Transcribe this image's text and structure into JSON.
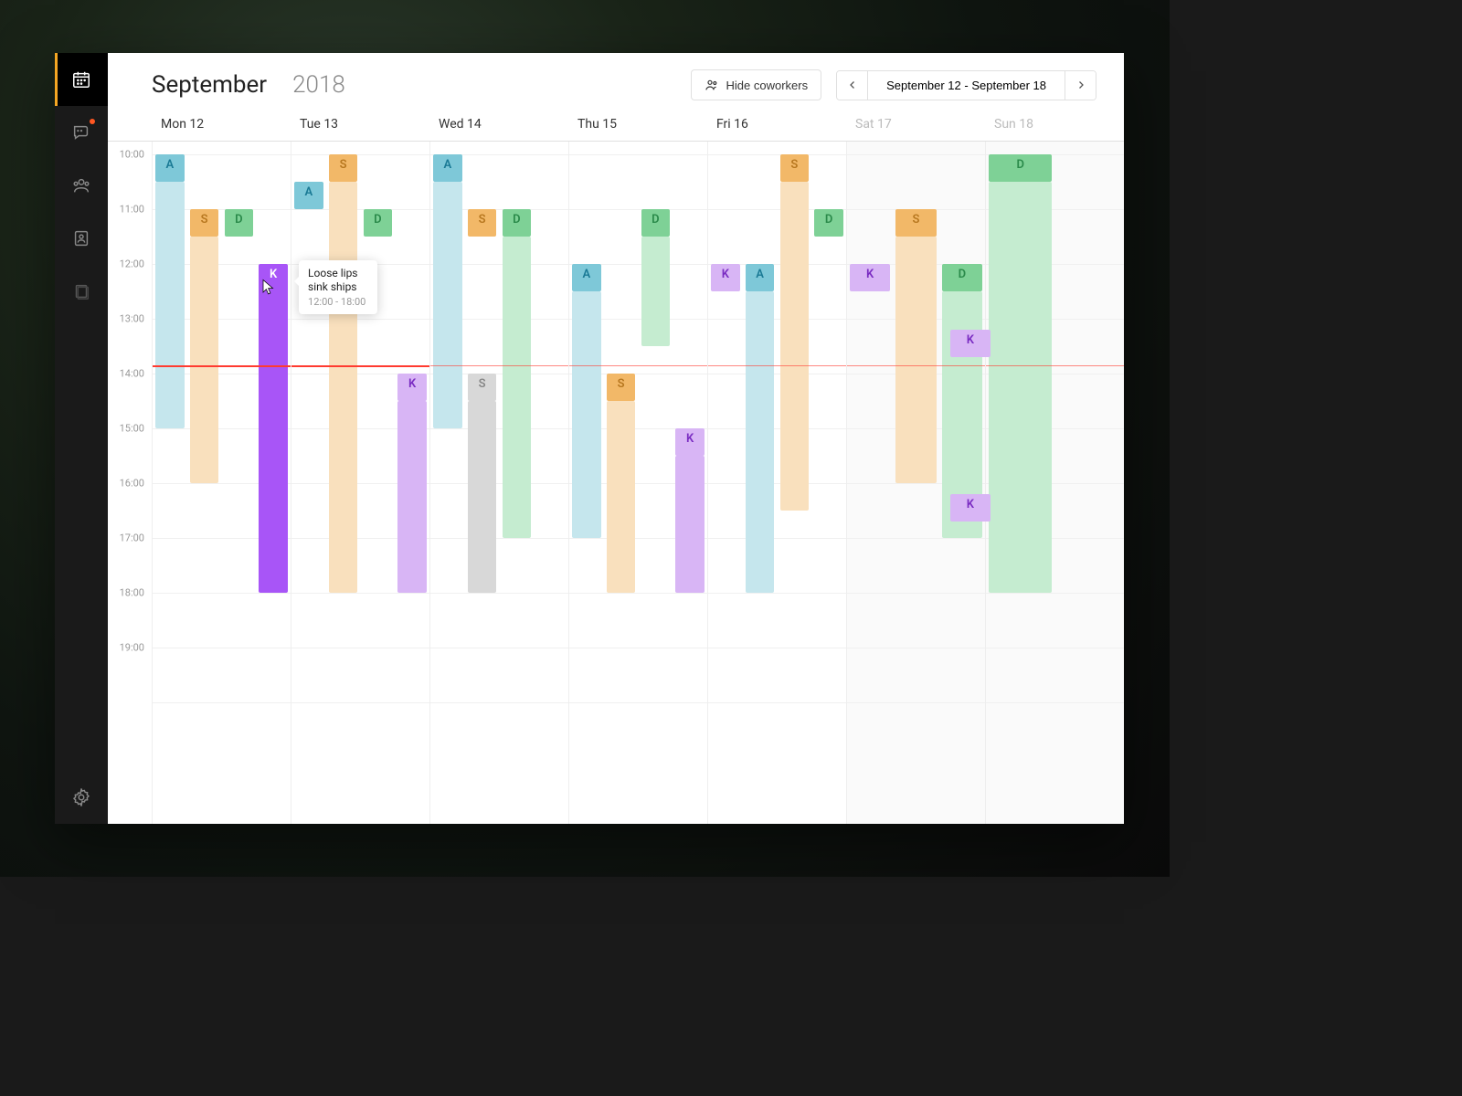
{
  "title": {
    "month": "September",
    "year": "2018"
  },
  "hide_coworkers": "Hide coworkers",
  "range": {
    "label": "September 12  -  September 18"
  },
  "days": [
    {
      "label": "Mon 12",
      "weekend": false
    },
    {
      "label": "Tue 13",
      "weekend": false
    },
    {
      "label": "Wed 14",
      "weekend": false
    },
    {
      "label": "Thu 15",
      "weekend": false
    },
    {
      "label": "Fri 16",
      "weekend": false
    },
    {
      "label": "Sat 17",
      "weekend": true
    },
    {
      "label": "Sun 18",
      "weekend": true
    }
  ],
  "hours": [
    "10:00",
    "11:00",
    "12:00",
    "13:00",
    "14:00",
    "15:00",
    "16:00",
    "17:00",
    "18:00",
    "19:00"
  ],
  "hour_start": 10,
  "hour_end": 20,
  "hour_height": 60,
  "now_hour": 13.85,
  "tooltip": {
    "title": "Loose lips sink ships",
    "time": "12:00 - 18:00"
  },
  "people": {
    "A": "A",
    "S": "S",
    "D": "D",
    "K": "K"
  },
  "events": [
    {
      "day": 0,
      "lane": 0,
      "lanes": 4,
      "start": 10,
      "end": 10.5,
      "who": "A",
      "cls": "ev-a-solid"
    },
    {
      "day": 0,
      "lane": 0,
      "lanes": 4,
      "start": 10.5,
      "end": 15,
      "who": "",
      "cls": "ev-a-light"
    },
    {
      "day": 0,
      "lane": 1,
      "lanes": 4,
      "start": 11,
      "end": 11.5,
      "who": "S",
      "cls": "ev-s-solid"
    },
    {
      "day": 0,
      "lane": 1,
      "lanes": 4,
      "start": 11.5,
      "end": 16,
      "who": "",
      "cls": "ev-s-light"
    },
    {
      "day": 0,
      "lane": 2,
      "lanes": 4,
      "start": 11,
      "end": 11.5,
      "who": "D",
      "cls": "ev-d-solid"
    },
    {
      "day": 0,
      "lane": 3,
      "lanes": 4,
      "start": 12,
      "end": 18,
      "who": "K",
      "cls": "ev-k-solid",
      "tooltip": true
    },
    {
      "day": 1,
      "lane": 0,
      "lanes": 4,
      "start": 10.5,
      "end": 11,
      "who": "A",
      "cls": "ev-a-solid"
    },
    {
      "day": 1,
      "lane": 1,
      "lanes": 4,
      "start": 10,
      "end": 10.5,
      "who": "S",
      "cls": "ev-s-solid"
    },
    {
      "day": 1,
      "lane": 1,
      "lanes": 4,
      "start": 10.5,
      "end": 18,
      "who": "",
      "cls": "ev-s-light"
    },
    {
      "day": 1,
      "lane": 2,
      "lanes": 4,
      "start": 11,
      "end": 11.5,
      "who": "D",
      "cls": "ev-d-solid"
    },
    {
      "day": 1,
      "lane": 3,
      "lanes": 4,
      "start": 14,
      "end": 14.5,
      "who": "K",
      "cls": "ev-k-light"
    },
    {
      "day": 1,
      "lane": 3,
      "lanes": 4,
      "start": 14.5,
      "end": 18,
      "who": "",
      "cls": "ev-k-light"
    },
    {
      "day": 2,
      "lane": 0,
      "lanes": 4,
      "start": 10,
      "end": 10.5,
      "who": "A",
      "cls": "ev-a-solid"
    },
    {
      "day": 2,
      "lane": 0,
      "lanes": 4,
      "start": 10.5,
      "end": 15,
      "who": "",
      "cls": "ev-a-light"
    },
    {
      "day": 2,
      "lane": 1,
      "lanes": 4,
      "start": 11,
      "end": 11.5,
      "who": "S",
      "cls": "ev-s-solid"
    },
    {
      "day": 2,
      "lane": 1,
      "lanes": 4,
      "start": 14,
      "end": 14.5,
      "who": "S",
      "cls": "ev-s-gray"
    },
    {
      "day": 2,
      "lane": 1,
      "lanes": 4,
      "start": 14.5,
      "end": 18,
      "who": "",
      "cls": "ev-s-gray"
    },
    {
      "day": 2,
      "lane": 2,
      "lanes": 4,
      "start": 11,
      "end": 11.5,
      "who": "D",
      "cls": "ev-d-solid"
    },
    {
      "day": 2,
      "lane": 2,
      "lanes": 4,
      "start": 11.5,
      "end": 17,
      "who": "",
      "cls": "ev-d-light"
    },
    {
      "day": 3,
      "lane": 0,
      "lanes": 4,
      "start": 12,
      "end": 12.5,
      "who": "A",
      "cls": "ev-a-solid"
    },
    {
      "day": 3,
      "lane": 0,
      "lanes": 4,
      "start": 12.5,
      "end": 17,
      "who": "",
      "cls": "ev-a-light"
    },
    {
      "day": 3,
      "lane": 1,
      "lanes": 4,
      "start": 14,
      "end": 14.5,
      "who": "S",
      "cls": "ev-s-solid"
    },
    {
      "day": 3,
      "lane": 1,
      "lanes": 4,
      "start": 14.5,
      "end": 18,
      "who": "",
      "cls": "ev-s-light"
    },
    {
      "day": 3,
      "lane": 2,
      "lanes": 4,
      "start": 11,
      "end": 11.5,
      "who": "D",
      "cls": "ev-d-solid"
    },
    {
      "day": 3,
      "lane": 2,
      "lanes": 4,
      "start": 11.5,
      "end": 13.5,
      "who": "",
      "cls": "ev-d-light"
    },
    {
      "day": 3,
      "lane": 3,
      "lanes": 4,
      "start": 15,
      "end": 15.5,
      "who": "K",
      "cls": "ev-k-light"
    },
    {
      "day": 3,
      "lane": 3,
      "lanes": 4,
      "start": 15.5,
      "end": 18,
      "who": "",
      "cls": "ev-k-light"
    },
    {
      "day": 4,
      "lane": 0,
      "lanes": 4,
      "start": 12,
      "end": 12.5,
      "who": "K",
      "cls": "ev-k-light"
    },
    {
      "day": 4,
      "lane": 1,
      "lanes": 4,
      "start": 12,
      "end": 12.5,
      "who": "A",
      "cls": "ev-a-solid"
    },
    {
      "day": 4,
      "lane": 1,
      "lanes": 4,
      "start": 12.5,
      "end": 18,
      "who": "",
      "cls": "ev-a-light"
    },
    {
      "day": 4,
      "lane": 2,
      "lanes": 4,
      "start": 10,
      "end": 10.5,
      "who": "S",
      "cls": "ev-s-solid"
    },
    {
      "day": 4,
      "lane": 2,
      "lanes": 4,
      "start": 10.5,
      "end": 16.5,
      "who": "",
      "cls": "ev-s-light"
    },
    {
      "day": 4,
      "lane": 3,
      "lanes": 4,
      "start": 11,
      "end": 11.5,
      "who": "D",
      "cls": "ev-d-solid"
    },
    {
      "day": 5,
      "lane": 0,
      "lanes": 3,
      "start": 12,
      "end": 12.5,
      "who": "K",
      "cls": "ev-k-light"
    },
    {
      "day": 5,
      "lane": 1,
      "lanes": 3,
      "start": 11,
      "end": 11.5,
      "who": "S",
      "cls": "ev-s-solid"
    },
    {
      "day": 5,
      "lane": 1,
      "lanes": 3,
      "start": 11.5,
      "end": 16,
      "who": "",
      "cls": "ev-s-light"
    },
    {
      "day": 5,
      "lane": 2,
      "lanes": 3,
      "start": 12,
      "end": 12.5,
      "who": "D",
      "cls": "ev-d-solid"
    },
    {
      "day": 5,
      "lane": 2,
      "lanes": 3,
      "start": 12.5,
      "end": 17,
      "who": "",
      "cls": "ev-d-light"
    },
    {
      "day": 5,
      "lane": 2,
      "lanes": 3,
      "start": 13.2,
      "end": 13.7,
      "who": "K",
      "cls": "ev-k-light",
      "over": true
    },
    {
      "day": 5,
      "lane": 2,
      "lanes": 3,
      "start": 16.2,
      "end": 16.7,
      "who": "K",
      "cls": "ev-k-light",
      "over": true
    },
    {
      "day": 6,
      "lane": 0,
      "lanes": 2,
      "start": 10,
      "end": 10.5,
      "who": "D",
      "cls": "ev-d-solid"
    },
    {
      "day": 6,
      "lane": 0,
      "lanes": 2,
      "start": 10.5,
      "end": 18,
      "who": "",
      "cls": "ev-d-light"
    }
  ]
}
